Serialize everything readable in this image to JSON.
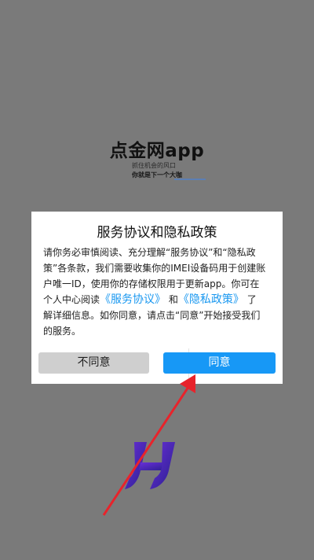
{
  "splash": {
    "app_title": "点金网app",
    "slogan_line1": "抓住机会的风口",
    "slogan_line2": "你就是下一个大咖"
  },
  "dialog": {
    "title": "服务协议和隐私政策",
    "body_line1": "请你务必审慎阅读、充分理解“服务协议”和“隐私政",
    "body_line2": "策”各条款，我们需要收集你的IMEI设备码用于创建账",
    "body_line3": "户唯一ID，使用你的存储权限用于更新app。你可在",
    "body_line4_prefix": "个人中心阅读",
    "service_agreement_link": "《服务协议》",
    "body_line4_and": "和",
    "privacy_policy_link": "《隐私政策》",
    "body_line4_suffix": "了",
    "body_line5": "解详细信息。如你同意，请点击“同意”开始接受我们",
    "body_line6": "的服务。",
    "cancel_label": "不同意",
    "agree_label": "同意"
  },
  "colors": {
    "overlay": "#7a7a7a",
    "agree_button": "#1798f6",
    "link": "#1a98f0",
    "cancel_button": "#cfcfcf",
    "annotation_arrow": "#e8232b"
  }
}
